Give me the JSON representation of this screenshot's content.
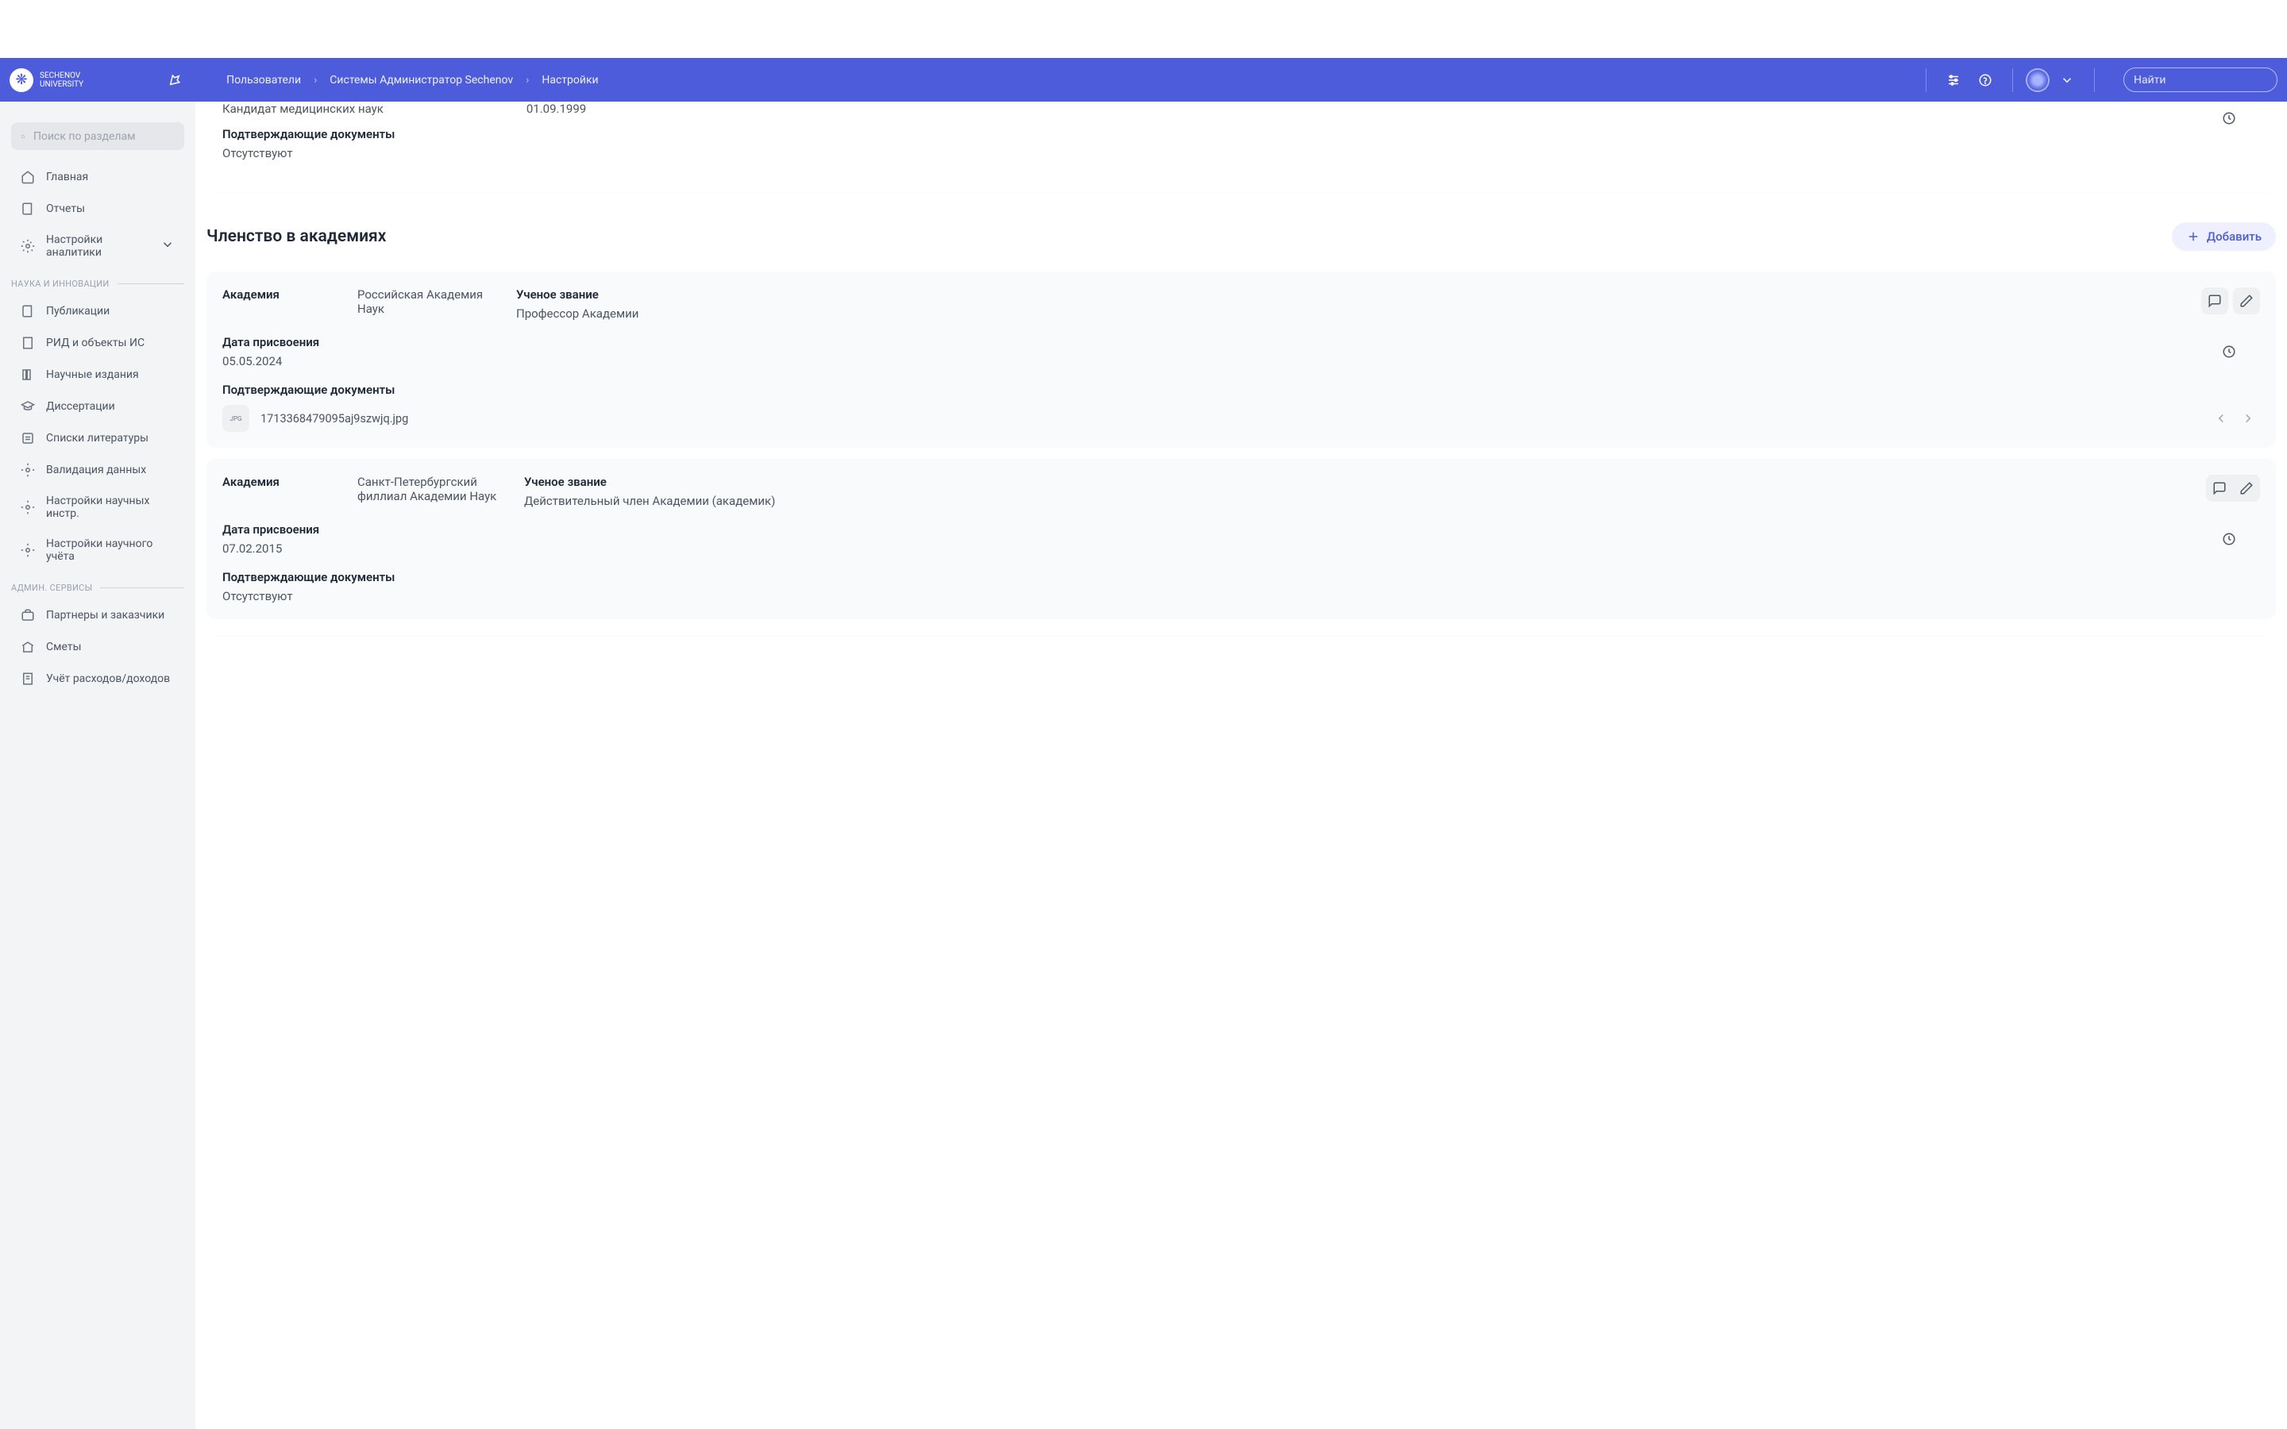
{
  "header": {
    "logo_line1": "SECHENOV",
    "logo_line2": "UNIVERSITY",
    "breadcrumb": [
      "Пользователи",
      "Системы Администратор Sechenov",
      "Настройки"
    ],
    "search_placeholder": "Найти"
  },
  "sidebar": {
    "search_placeholder": "Поиск по разделам",
    "items_top": [
      {
        "label": "Главная",
        "icon": "home"
      },
      {
        "label": "Отчеты",
        "icon": "book"
      },
      {
        "label": "Настройки аналитики",
        "icon": "gear",
        "has_chevron": true
      }
    ],
    "section1": "НАУКА И ИННОВАЦИИ",
    "items_sci": [
      {
        "label": "Публикации",
        "icon": "book"
      },
      {
        "label": "РИД и объекты ИС",
        "icon": "building"
      },
      {
        "label": "Научные издания",
        "icon": "books"
      },
      {
        "label": "Диссертации",
        "icon": "cap"
      },
      {
        "label": "Списки литературы",
        "icon": "list"
      },
      {
        "label": "Валидация данных",
        "icon": "gear"
      },
      {
        "label": "Настройки научных инстр.",
        "icon": "gear"
      },
      {
        "label": "Настройки научного учёта",
        "icon": "gear"
      }
    ],
    "section2": "АДМИН. СЕРВИСЫ",
    "items_admin": [
      {
        "label": "Партнеры и заказчики",
        "icon": "briefcase"
      },
      {
        "label": "Сметы",
        "icon": "bank"
      },
      {
        "label": "Учёт расходов/доходов",
        "icon": "receipt"
      }
    ]
  },
  "partial_card": {
    "degree_value": "Кандидат медицинских наук",
    "date_value": "01.09.1999",
    "docs_label": "Подтверждающие документы",
    "docs_value": "Отсутствуют"
  },
  "membership": {
    "title": "Членство в академиях",
    "add_label": "Добавить",
    "labels": {
      "academy": "Академия",
      "rank": "Ученое звание",
      "assign_date": "Дата присвоения",
      "docs": "Подтверждающие документы"
    },
    "entries": [
      {
        "academy": "Российская Академия Наук",
        "rank": "Профессор Академии",
        "date": "05.05.2024",
        "doc_name": "1713368479095aj9szwjq.jpg",
        "docs_absent": null
      },
      {
        "academy": "Санкт-Петербургский филлиал Академии Наук",
        "rank": "Действительный член Академии (академик)",
        "date": "07.02.2015",
        "doc_name": null,
        "docs_absent": "Отсутствуют"
      }
    ]
  }
}
